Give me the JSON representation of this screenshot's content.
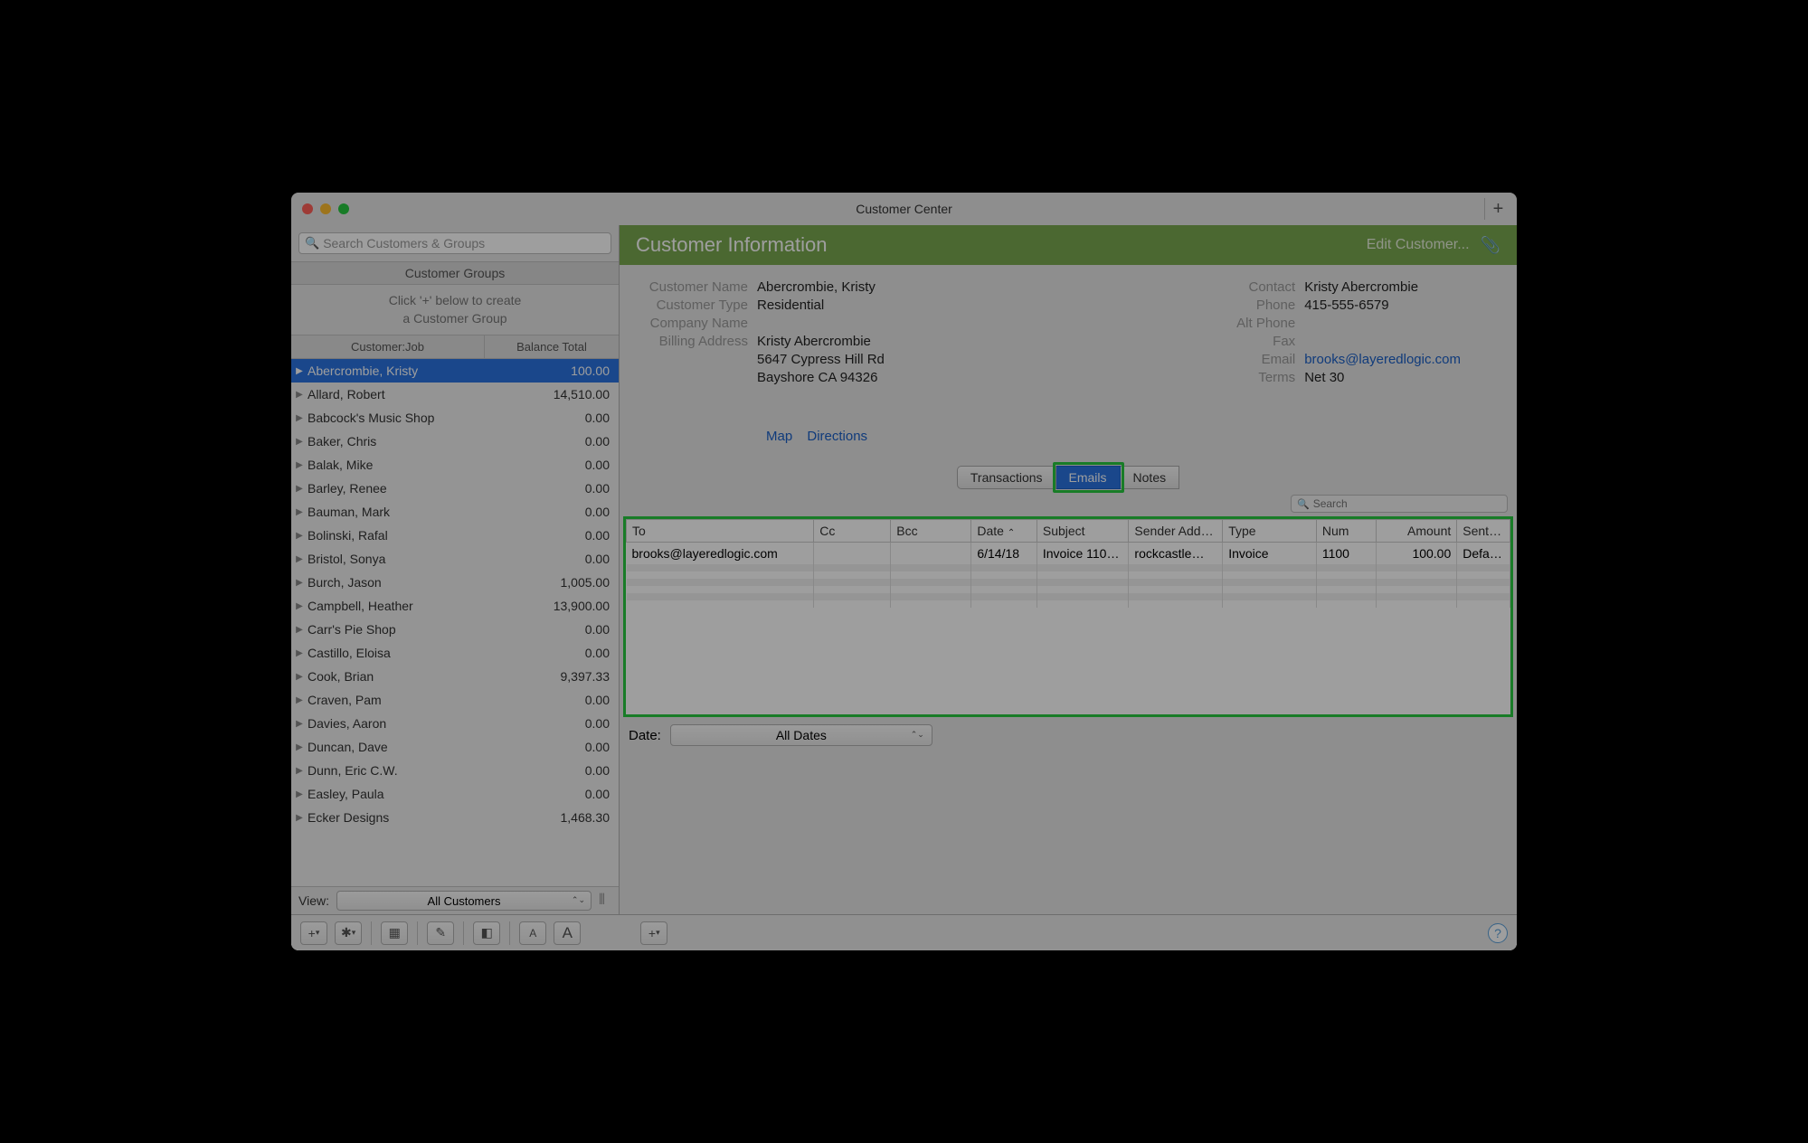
{
  "window_title": "Customer Center",
  "search_placeholder": "Search Customers & Groups",
  "group_header": "Customer Groups",
  "group_hint_line1": "Click '+' below to create",
  "group_hint_line2": "a Customer Group",
  "list_headers": {
    "name": "Customer:Job",
    "balance": "Balance Total"
  },
  "customers": [
    {
      "name": "Abercrombie, Kristy",
      "balance": "100.00",
      "selected": true
    },
    {
      "name": "Allard, Robert",
      "balance": "14,510.00"
    },
    {
      "name": "Babcock's Music Shop",
      "balance": "0.00"
    },
    {
      "name": "Baker, Chris",
      "balance": "0.00"
    },
    {
      "name": "Balak, Mike",
      "balance": "0.00"
    },
    {
      "name": "Barley, Renee",
      "balance": "0.00"
    },
    {
      "name": "Bauman, Mark",
      "balance": "0.00"
    },
    {
      "name": "Bolinski, Rafal",
      "balance": "0.00"
    },
    {
      "name": "Bristol, Sonya",
      "balance": "0.00"
    },
    {
      "name": "Burch, Jason",
      "balance": "1,005.00"
    },
    {
      "name": "Campbell, Heather",
      "balance": "13,900.00"
    },
    {
      "name": "Carr's Pie Shop",
      "balance": "0.00"
    },
    {
      "name": "Castillo, Eloisa",
      "balance": "0.00"
    },
    {
      "name": "Cook, Brian",
      "balance": "9,397.33"
    },
    {
      "name": "Craven, Pam",
      "balance": "0.00"
    },
    {
      "name": "Davies, Aaron",
      "balance": "0.00"
    },
    {
      "name": "Duncan, Dave",
      "balance": "0.00"
    },
    {
      "name": "Dunn, Eric C.W.",
      "balance": "0.00"
    },
    {
      "name": "Easley, Paula",
      "balance": "0.00"
    },
    {
      "name": "Ecker Designs",
      "balance": "1,468.30"
    }
  ],
  "view_label": "View:",
  "view_value": "All Customers",
  "info_header": "Customer Information",
  "edit_label": "Edit Customer...",
  "info_left": {
    "customer_name_label": "Customer Name",
    "customer_name": "Abercrombie, Kristy",
    "customer_type_label": "Customer Type",
    "customer_type": "Residential",
    "company_name_label": "Company Name",
    "company_name": "",
    "billing_address_label": "Billing Address",
    "billing_1": "Kristy Abercrombie",
    "billing_2": "5647 Cypress Hill Rd",
    "billing_3": "Bayshore CA 94326",
    "map": "Map",
    "directions": "Directions"
  },
  "info_right": {
    "contact_label": "Contact",
    "contact": "Kristy Abercrombie",
    "phone_label": "Phone",
    "phone": "415-555-6579",
    "alt_phone_label": "Alt Phone",
    "alt_phone": "",
    "fax_label": "Fax",
    "fax": "",
    "email_label": "Email",
    "email": "brooks@layeredlogic.com",
    "terms_label": "Terms",
    "terms": "Net 30"
  },
  "tabs": {
    "transactions": "Transactions",
    "emails": "Emails",
    "notes": "Notes"
  },
  "search_right": "Search",
  "email_headers": {
    "to": "To",
    "cc": "Cc",
    "bcc": "Bcc",
    "date": "Date",
    "subject": "Subject",
    "sender": "Sender Add…",
    "type": "Type",
    "num": "Num",
    "amount": "Amount",
    "sent": "Sent…"
  },
  "email_rows": [
    {
      "to": "brooks@layeredlogic.com",
      "cc": "",
      "bcc": "",
      "date": "6/14/18",
      "subject": "Invoice 110…",
      "sender": "rockcastle…",
      "type": "Invoice",
      "num": "1100",
      "amount": "100.00",
      "sent": "Defa…"
    }
  ],
  "date_label": "Date:",
  "date_value": "All Dates"
}
